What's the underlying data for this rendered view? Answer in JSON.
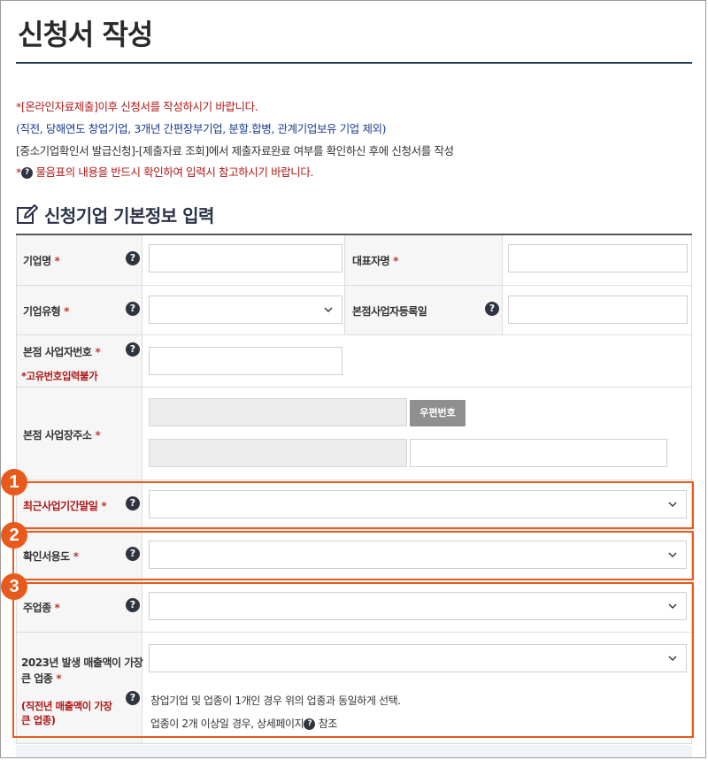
{
  "page": {
    "title": "신청서 작성"
  },
  "notices": {
    "line1": "*[온라인자료제출]이후 신청서를 작성하시기 바랍니다.",
    "line2": "(직전, 당해연도 창업기업, 3개년 간편장부기업, 분할.합병, 관계기업보유 기업 제외)",
    "line3": "[중소기업확인서 발급신청]-[제출자료 조회]에서 제출자료완료 여부를 확인하신 후에 신청서를 작성",
    "line4_prefix": "*",
    "line4_text": "물음표의 내용을 반드시 확인하여 입력시 참고하시기 바랍니다."
  },
  "section": {
    "title": "신청기업 기본정보 입력",
    "icon": "edit-icon"
  },
  "form": {
    "required_mark": "*",
    "company_name": {
      "label": "기업명",
      "value": ""
    },
    "ceo_name": {
      "label": "대표자명",
      "value": ""
    },
    "company_type": {
      "label": "기업유형",
      "value": ""
    },
    "hq_reg_date": {
      "label": "본점사업자등록일",
      "value": ""
    },
    "hq_biz_number": {
      "label": "본점 사업자번호",
      "hint": "*고유번호입력불가",
      "value": ""
    },
    "hq_address": {
      "label": "본점 사업장주소",
      "zip_button": "우편번호"
    },
    "recent_fiscal_end": {
      "label": "최근사업기간말일",
      "value": ""
    },
    "cert_purpose": {
      "label": "확인서용도",
      "value": ""
    },
    "main_industry": {
      "label": "주업종",
      "value": ""
    },
    "largest_sales_industry": {
      "label_line1": "2023년 발생 매출액이 가장",
      "label_line2": "큰 업종",
      "hint_line1": "(직전년 매출액이 가장",
      "hint_line2": "큰 업종)",
      "value": "",
      "info_line1": "창업기업 및 업종이 1개인 경우 위의 업종과 동일하게 선택.",
      "info_line2_prefix": "업종이 2개 이상일 경우, 상세페이지",
      "info_line2_suffix": "참조"
    }
  },
  "badges": [
    "1",
    "2",
    "3"
  ],
  "help_glyph": "?",
  "colors": {
    "accent": "#e85a1b",
    "required": "#c0392b",
    "notice_red": "#b01818",
    "notice_blue": "#1a3d8f",
    "title_rule": "#1f3a5a"
  }
}
